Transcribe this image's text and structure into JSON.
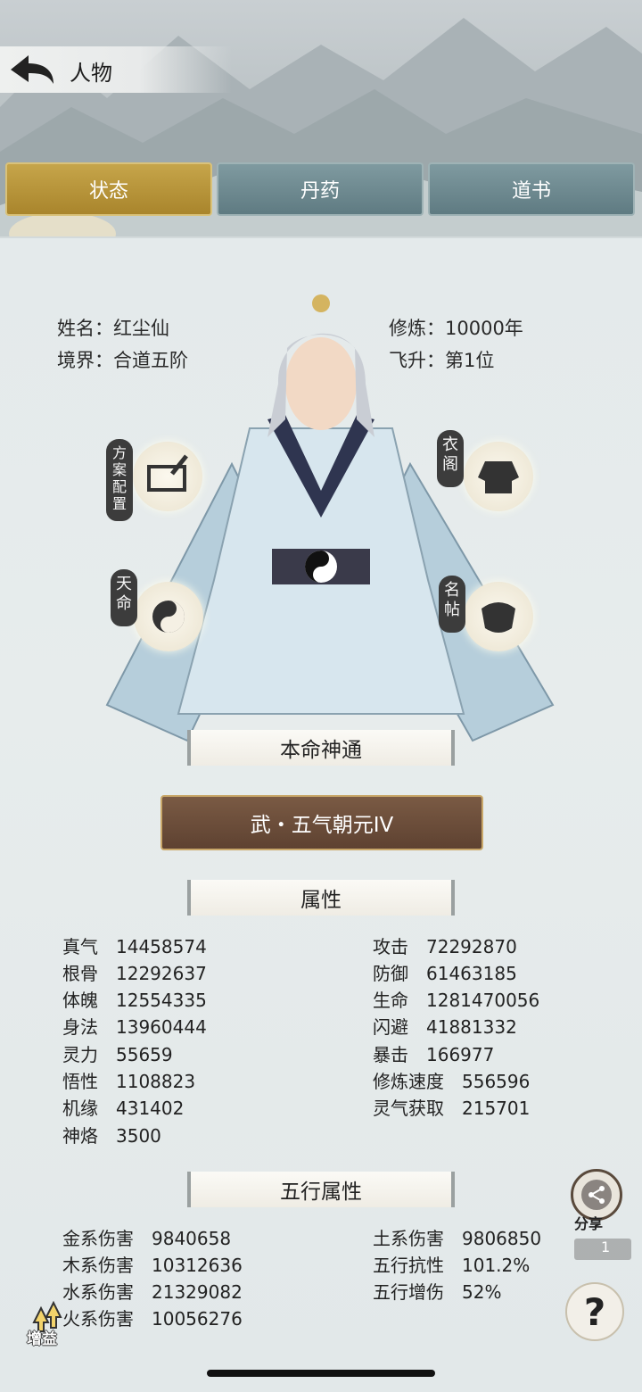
{
  "header": {
    "title": "人物"
  },
  "tabs": [
    {
      "label": "状态",
      "active": true
    },
    {
      "label": "丹药",
      "active": false
    },
    {
      "label": "道书",
      "active": false
    }
  ],
  "profile": {
    "name_label": "姓名：红尘仙",
    "realm_label": "境界：合道五阶",
    "cultivation_label": "修炼：10000年",
    "ascension_label": "飞升：第1位"
  },
  "side_buttons": {
    "scheme": "方案配置",
    "wardrobe": "衣阁",
    "fate": "天命",
    "title_card": "名帖"
  },
  "sections": {
    "innate": "本命神通",
    "attributes": "属性",
    "elements": "五行属性"
  },
  "skill": {
    "label": "武・五气朝元IV"
  },
  "attributes_left": [
    {
      "k": "真气",
      "v": "14458574"
    },
    {
      "k": "根骨",
      "v": "12292637"
    },
    {
      "k": "体魄",
      "v": "12554335"
    },
    {
      "k": "身法",
      "v": "13960444"
    },
    {
      "k": "灵力",
      "v": "55659"
    },
    {
      "k": "悟性",
      "v": "1108823"
    },
    {
      "k": "机缘",
      "v": "431402"
    },
    {
      "k": "神烙",
      "v": "3500"
    }
  ],
  "attributes_right": [
    {
      "k": "攻击",
      "v": "72292870"
    },
    {
      "k": "防御",
      "v": "61463185"
    },
    {
      "k": "生命",
      "v": "1281470056"
    },
    {
      "k": "闪避",
      "v": "41881332"
    },
    {
      "k": "暴击",
      "v": "166977"
    },
    {
      "k": "修炼速度",
      "v": "556596"
    },
    {
      "k": "灵气获取",
      "v": "215701"
    }
  ],
  "elements_left": [
    {
      "k": "金系伤害",
      "v": "9840658"
    },
    {
      "k": "木系伤害",
      "v": "10312636"
    },
    {
      "k": "水系伤害",
      "v": "21329082"
    },
    {
      "k": "火系伤害",
      "v": "10056276"
    }
  ],
  "elements_right": [
    {
      "k": "土系伤害",
      "v": "9806850"
    },
    {
      "k": "五行抗性",
      "v": "101.2%"
    },
    {
      "k": "五行增伤",
      "v": "52%"
    }
  ],
  "floating": {
    "share_label": "分享",
    "badge_count": "1",
    "boost_label": "增益",
    "help_label": "?"
  }
}
